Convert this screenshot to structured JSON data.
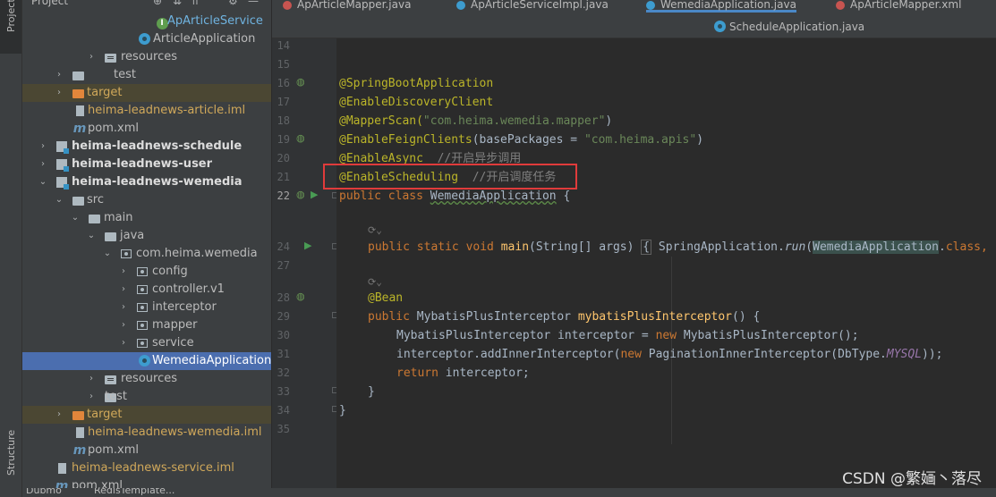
{
  "toolstrip": {
    "project_label": "Project",
    "structure_label": "Structure"
  },
  "project_panel": {
    "title": "Project",
    "toolbar_icons": [
      "globe-icon",
      "expand-all-icon",
      "collapse-all-icon",
      "settings-icon",
      "hide-icon"
    ],
    "tree": [
      {
        "label": "ApArticleService",
        "kind": "interface"
      },
      {
        "label": "ArticleApplication",
        "kind": "class"
      },
      {
        "label": "resources",
        "kind": "res-folder"
      },
      {
        "label": "test",
        "kind": "folder"
      },
      {
        "label": "target",
        "kind": "orange-folder"
      },
      {
        "label": "heima-leadnews-article.iml",
        "kind": "iml"
      },
      {
        "label": "pom.xml",
        "kind": "maven"
      },
      {
        "label": "heima-leadnews-schedule",
        "kind": "module"
      },
      {
        "label": "heima-leadnews-user",
        "kind": "module"
      },
      {
        "label": "heima-leadnews-wemedia",
        "kind": "module"
      },
      {
        "label": "src",
        "kind": "folder"
      },
      {
        "label": "main",
        "kind": "folder"
      },
      {
        "label": "java",
        "kind": "folder"
      },
      {
        "label": "com.heima.wemedia",
        "kind": "package"
      },
      {
        "label": "config",
        "kind": "package"
      },
      {
        "label": "controller.v1",
        "kind": "package"
      },
      {
        "label": "interceptor",
        "kind": "package"
      },
      {
        "label": "mapper",
        "kind": "package"
      },
      {
        "label": "service",
        "kind": "package"
      },
      {
        "label": "WemediaApplication",
        "kind": "class"
      },
      {
        "label": "resources",
        "kind": "res-folder"
      },
      {
        "label": "test",
        "kind": "folder"
      },
      {
        "label": "target",
        "kind": "orange-folder"
      },
      {
        "label": "heima-leadnews-wemedia.iml",
        "kind": "iml"
      },
      {
        "label": "pom.xml",
        "kind": "maven"
      },
      {
        "label": "heima-leadnews-service.iml",
        "kind": "iml"
      },
      {
        "label": "pom.xml",
        "kind": "maven"
      }
    ]
  },
  "tabs": [
    {
      "label": "ApArticleMapper.java"
    },
    {
      "label": "ApArticleServiceImpl.java"
    },
    {
      "label": "WemediaApplication.java"
    },
    {
      "label": "ApArticleMapper.xml"
    }
  ],
  "subtab": {
    "label": "ScheduleApplication.java"
  },
  "editor": {
    "line_numbers": [
      "14",
      "15",
      "16",
      "17",
      "18",
      "19",
      "20",
      "21",
      "22",
      "",
      "24",
      "27",
      "",
      "28",
      "29",
      "30",
      "31",
      "32",
      "33",
      "34",
      "35"
    ],
    "code": {
      "l16": "@SpringBootApplication",
      "l17": "@EnableDiscoveryClient",
      "l18_a": "@MapperScan(",
      "l18_b": "\"com.heima.wemedia.mapper\"",
      "l18_c": ")",
      "l19_a": "@EnableFeignClients",
      "l19_b": "(basePackages = ",
      "l19_c": "\"com.heima.apis\"",
      "l19_d": ")",
      "l20_a": "@EnableAsync",
      "l20_b": "  //开启异步调用",
      "l21_a": "@EnableScheduling",
      "l21_b": "  //开启调度任务",
      "l22_a": "public class ",
      "l22_b": "WemediaApplication",
      "l22_c": " {",
      "l24_a": "public static void ",
      "l24_b": "main",
      "l24_c": "(String[] args) ",
      "l24_d": "{",
      "l24_e": " SpringApplication.",
      "l24_f": "run",
      "l24_g": "(",
      "l24_h": "WemediaApplication",
      "l24_i": ".",
      "l24_j": "class",
      "l24_k": ",",
      "l28": "@Bean",
      "l29_a": "public ",
      "l29_b": "MybatisPlusInterceptor ",
      "l29_c": "mybatisPlusInterceptor",
      "l29_d": "() {",
      "l30_a": "MybatisPlusInterceptor interceptor = ",
      "l30_b": "new ",
      "l30_c": "MybatisPlusInterceptor();",
      "l31_a": "interceptor.addInnerInterceptor(",
      "l31_b": "new ",
      "l31_c": "PaginationInnerInterceptor(DbType.",
      "l31_d": "MYSQL",
      "l31_e": "));",
      "l32_a": "return ",
      "l32_b": "interceptor;",
      "l33": "}",
      "l34": "}"
    },
    "hints": [
      "⟳⌄",
      "⟳⌄"
    ]
  },
  "watermark": "CSDN @繁婳丶落尽",
  "bottom": {
    "left": "Dubmo",
    "mid": "RedisTemplate..."
  }
}
